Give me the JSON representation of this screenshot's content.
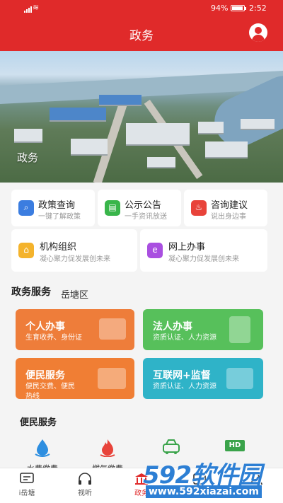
{
  "status_bar": {
    "battery": "94%",
    "battery_level": 0.94,
    "time": "2:52"
  },
  "header": {
    "title": "政务"
  },
  "banner": {
    "label": "政务"
  },
  "quick_services": [
    {
      "title": "政策查询",
      "subtitle": "一键了解政策",
      "icon": "search-icon",
      "color": "#3b7de0"
    },
    {
      "title": "公示公告",
      "subtitle": "一手资讯放送",
      "icon": "notice-icon",
      "color": "#39b54a"
    },
    {
      "title": "咨询建议",
      "subtitle": "说出身边事",
      "icon": "fire-icon",
      "color": "#e8433a"
    },
    {
      "title": "机构组织",
      "subtitle": "凝心聚力促发展创未来",
      "icon": "building-icon",
      "color": "#f4b32c"
    },
    {
      "title": "网上办事",
      "subtitle": "凝心聚力促发展创未来",
      "icon": "browser-icon",
      "color": "#a94fe0"
    }
  ],
  "government_services": {
    "title": "政务服务",
    "district": "岳塘区",
    "cards": [
      {
        "title": "个人办事",
        "desc": "生育收养、身份证",
        "color": "#ee7d3a"
      },
      {
        "title": "法人办事",
        "desc": "资质认证、人力资源",
        "color": "#57c05b"
      },
      {
        "title": "便民服务",
        "desc": "便民交费、便民热线",
        "color": "#f07e34"
      },
      {
        "title": "互联网+监督",
        "desc": "资质认证、人力资源",
        "color": "#2fb3c8"
      }
    ]
  },
  "convenience": {
    "title": "便民服务",
    "items": [
      {
        "label": "水费缴费",
        "icon": "water-drop-icon"
      },
      {
        "label": "燃气缴费",
        "icon": "flame-icon"
      },
      {
        "label": "",
        "icon": "car-icon"
      },
      {
        "label": "",
        "icon": "hd-icon",
        "badge": "HD"
      }
    ]
  },
  "bottom_nav": [
    {
      "label": "i岳塘",
      "icon": "chat-icon"
    },
    {
      "label": "视听",
      "icon": "headphones-icon"
    },
    {
      "label": "政务",
      "icon": "government-icon",
      "active": true
    },
    {
      "label": "",
      "icon": "service-icon"
    },
    {
      "label": "",
      "icon": "profile-icon"
    }
  ],
  "watermark": {
    "brand": "592软件园",
    "url": "www.592xiazai.com"
  },
  "colors": {
    "primary": "#e02a2a"
  }
}
